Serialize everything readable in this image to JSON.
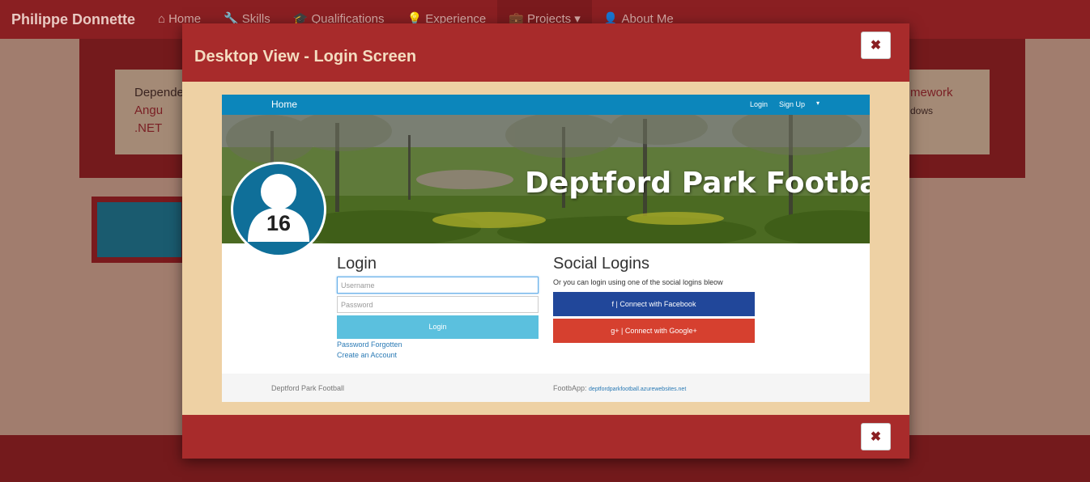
{
  "background_site": {
    "brand": "Philippe Donnette",
    "nav": [
      {
        "icon": "home-icon",
        "glyph": "⌂",
        "label": "Home"
      },
      {
        "icon": "wrench-icon",
        "glyph": "🔧",
        "label": "Skills"
      },
      {
        "icon": "graduation-cap-icon",
        "glyph": "🎓",
        "label": "Qualifications"
      },
      {
        "icon": "lightbulb-icon",
        "glyph": "💡",
        "label": "Experience"
      },
      {
        "icon": "briefcase-icon",
        "glyph": "💼",
        "label": "Projects ▾"
      },
      {
        "icon": "user-icon",
        "glyph": "👤",
        "label": "About Me"
      }
    ],
    "card_left_line1": "Depende",
    "card_left_line2": "Angu",
    "card_left_line3": ".NET",
    "card_right_line1": "mework",
    "card_right_line2": "dows"
  },
  "modal": {
    "title": "Desktop View - Login Screen",
    "close_glyph": "✖"
  },
  "screenshot": {
    "nav": {
      "home": "Home",
      "login": "Login",
      "signup": "Sign Up",
      "caret": "▾"
    },
    "hero_title": "Deptford Park Football",
    "avatar_number": "16",
    "login": {
      "heading": "Login",
      "username_placeholder": "Username",
      "password_placeholder": "Password",
      "button": "Login",
      "forgot": "Password Forgotten",
      "create": "Create an Account"
    },
    "social": {
      "heading": "Social Logins",
      "description": "Or you can login using one of the social logins bleow",
      "facebook": "f  |  Connect with Facebook",
      "google": "g+  |  Connect with Google+"
    },
    "footer": {
      "left": "Deptford Park Football",
      "right_label": "FootbApp: ",
      "right_url": "deptfordparkfootball.azurewebsites.net"
    }
  },
  "colors": {
    "modal_header": "#a82b2b",
    "modal_body": "#eed1a4",
    "site_nav": "#0c86bb",
    "facebook": "#21479a",
    "google": "#d6402f",
    "login_button": "#5bc0de"
  }
}
